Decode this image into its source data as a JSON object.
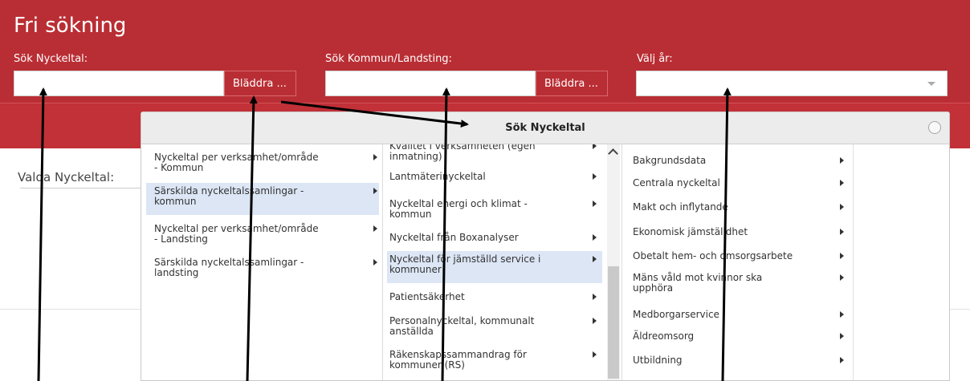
{
  "header": {
    "title": "Fri sökning",
    "search_kpi_label": "Sök Nyckeltal:",
    "search_muni_label": "Sök Kommun/Landsting:",
    "year_label": "Välj år:",
    "browse_label": "Bläddra ...",
    "browse_label_2": "Bläddra ...",
    "kpi_value": "",
    "muni_value": "",
    "year_value": ""
  },
  "selected_label": "Valda Nyckeltal:",
  "modal": {
    "title": "Sök Nyckeltal",
    "col1": [
      "Nyckeltal per verksamhet/område\n- Kommun",
      "Särskilda nyckeltalssamlingar -\nkommun",
      "Nyckeltal per verksamhet/område\n- Landsting",
      "Särskilda nyckeltalssamlingar -\nlandsting"
    ],
    "col2": [
      "Kvalitet i verksamheten (egen\ninmatning)",
      "Lantmäterinyckeltal",
      "Nyckeltal energi och klimat -\nkommun",
      "Nyckeltal från Boxanalyser",
      "Nyckeltal för jämställd service i\nkommuner",
      "Patientsäkerhet",
      "Personalnyckeltal, kommunalt\nanställda",
      "Räkenskapssammandrag för\nkommuner (RS)"
    ],
    "col3": [
      "Bakgrundsdata",
      "Centrala nyckeltal",
      "Makt och inflytande",
      "Ekonomisk jämställdhet",
      "Obetalt hem- och omsorgsarbete",
      "Mäns våld mot kvinnor ska\nupphöra",
      "Medborgarservice",
      "Äldreomsorg",
      "Utbildning"
    ]
  }
}
